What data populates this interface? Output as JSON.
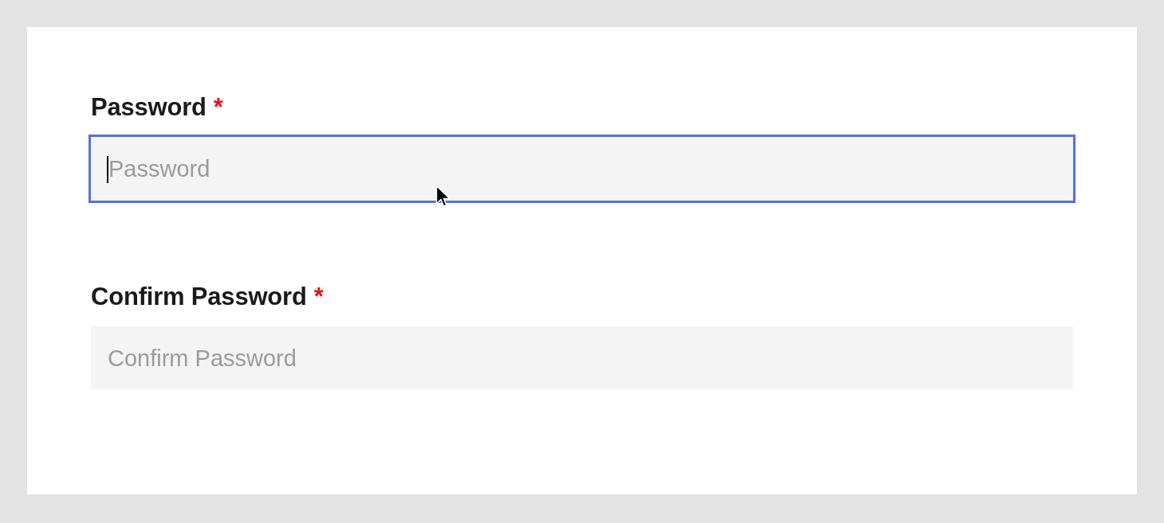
{
  "fields": [
    {
      "label": "Password",
      "required_mark": "*",
      "placeholder": "Password",
      "focused": true
    },
    {
      "label": "Confirm Password",
      "required_mark": "*",
      "placeholder": "Confirm Password",
      "focused": false
    }
  ]
}
